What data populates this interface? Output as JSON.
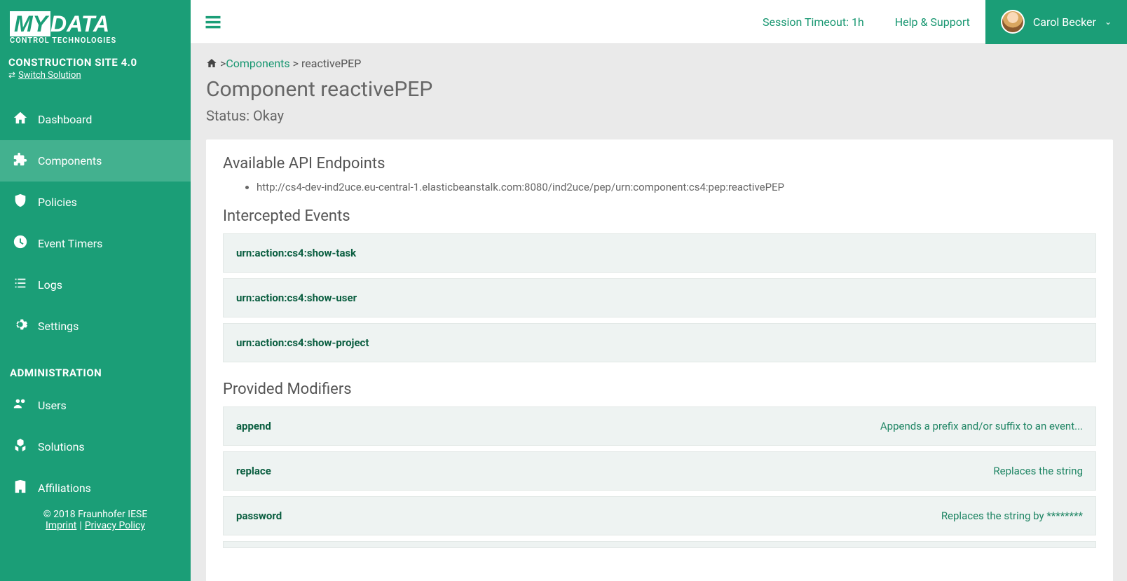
{
  "brand": {
    "logo_my": "MY",
    "logo_data": "DATA",
    "logo_sub": "CONTROL TECHNOLOGIES"
  },
  "solution": {
    "name": "CONSTRUCTION SITE 4.0",
    "switch_label": "Switch Solution"
  },
  "sidebar": {
    "items": [
      {
        "label": "Dashboard"
      },
      {
        "label": "Components"
      },
      {
        "label": "Policies"
      },
      {
        "label": "Event Timers"
      },
      {
        "label": "Logs"
      },
      {
        "label": "Settings"
      }
    ],
    "admin_header": "ADMINISTRATION",
    "admin_items": [
      {
        "label": "Users"
      },
      {
        "label": "Solutions"
      },
      {
        "label": "Affiliations"
      }
    ]
  },
  "footer": {
    "copyright": "© 2018 Fraunhofer IESE",
    "imprint": "Imprint",
    "privacy": "Privacy Policy"
  },
  "topbar": {
    "session": "Session Timeout: 1h",
    "help": "Help & Support",
    "user": "Carol Becker"
  },
  "breadcrumb": {
    "components": "Components",
    "current": "reactivePEP"
  },
  "page": {
    "title": "Component reactivePEP",
    "status_label": "Status: Okay",
    "api_header": "Available API Endpoints",
    "api_endpoints": [
      "http://cs4-dev-ind2uce.eu-central-1.elasticbeanstalk.com:8080/ind2uce/pep/urn:component:cs4:pep:reactivePEP"
    ],
    "events_header": "Intercepted Events",
    "events": [
      "urn:action:cs4:show-task",
      "urn:action:cs4:show-user",
      "urn:action:cs4:show-project"
    ],
    "modifiers_header": "Provided Modifiers",
    "modifiers": [
      {
        "name": "append",
        "desc": "Appends a prefix and/or suffix to an event..."
      },
      {
        "name": "replace",
        "desc": "Replaces the string"
      },
      {
        "name": "password",
        "desc": "Replaces the string by ********"
      }
    ]
  }
}
